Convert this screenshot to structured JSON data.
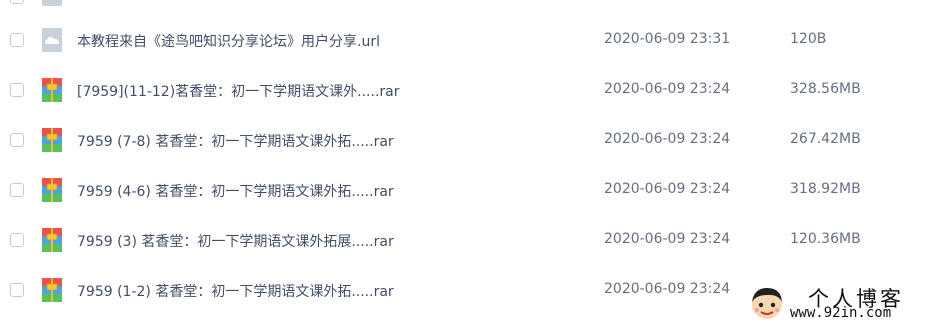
{
  "colors": {
    "cloud_icon": "#c8d1dc",
    "rar_red": "#e8534b",
    "rar_blue": "#4aa3ea",
    "rar_green": "#5bbf5a",
    "rar_yellow": "#f5c533"
  },
  "files": [
    {
      "icon": "cloud-file-icon",
      "name": "本教程来自《途鸟吧知识分享论坛》用户分享.url",
      "date": "2020-06-09 23:31",
      "size": "120B"
    },
    {
      "icon": "rar-archive-icon",
      "name": "[7959](11-12)茗香堂：初一下学期语文课外.....rar",
      "date": "2020-06-09 23:24",
      "size": "328.56MB"
    },
    {
      "icon": "rar-archive-icon",
      "name": "7959 (7-8) 茗香堂：初一下学期语文课外拓.....rar",
      "date": "2020-06-09 23:24",
      "size": "267.42MB"
    },
    {
      "icon": "rar-archive-icon",
      "name": "7959 (4-6) 茗香堂：初一下学期语文课外拓.....rar",
      "date": "2020-06-09 23:24",
      "size": "318.92MB"
    },
    {
      "icon": "rar-archive-icon",
      "name": "7959 (3) 茗香堂：初一下学期语文课外拓展.....rar",
      "date": "2020-06-09 23:24",
      "size": "120.36MB"
    },
    {
      "icon": "rar-archive-icon",
      "name": "7959 (1-2) 茗香堂：初一下学期语文课外拓.....rar",
      "date": "2020-06-09 23:24",
      "size": ""
    }
  ],
  "watermark": {
    "title": "个人博客",
    "url": "www.92in.com"
  }
}
